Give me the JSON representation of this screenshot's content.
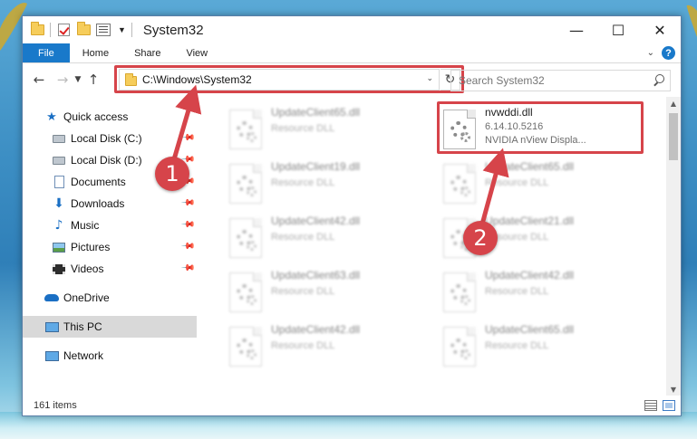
{
  "window": {
    "title": "System32",
    "controls": {
      "minimize": "—",
      "maximize": "☐",
      "close": "✕"
    }
  },
  "ribbon": {
    "tabs": [
      "File",
      "Home",
      "Share",
      "View"
    ],
    "help": "?"
  },
  "nav": {
    "address": "C:\\Windows\\System32",
    "search_placeholder": "Search System32"
  },
  "sidebar": {
    "items": [
      {
        "label": "Quick access",
        "icon": "star-icon",
        "pinned": false
      },
      {
        "label": "Local Disk (C:)",
        "icon": "drive-icon",
        "pinned": true
      },
      {
        "label": "Local Disk (D:)",
        "icon": "drive-icon",
        "pinned": true
      },
      {
        "label": "Documents",
        "icon": "documents-icon",
        "pinned": true
      },
      {
        "label": "Downloads",
        "icon": "download-icon",
        "pinned": true
      },
      {
        "label": "Music",
        "icon": "music-icon",
        "pinned": true
      },
      {
        "label": "Pictures",
        "icon": "pictures-icon",
        "pinned": true
      },
      {
        "label": "Videos",
        "icon": "videos-icon",
        "pinned": true
      },
      {
        "label": "OneDrive",
        "icon": "onedrive-icon",
        "pinned": false
      },
      {
        "label": "This PC",
        "icon": "this-pc-icon",
        "pinned": false,
        "selected": true
      },
      {
        "label": "Network",
        "icon": "network-icon",
        "pinned": false
      }
    ]
  },
  "files": {
    "featured": {
      "name": "nvwddi.dll",
      "version": "6.14.10.5216",
      "description": "NVIDIA nView Displa..."
    },
    "items": [
      {
        "name": "UpdateClient65.dll",
        "type": "Resource DLL"
      },
      {
        "name": "UpdateClient19.dll",
        "type": "Resource DLL"
      },
      {
        "name": "UpdateClient65.dll",
        "type": "Resource DLL"
      },
      {
        "name": "UpdateClient42.dll",
        "type": "Resource DLL"
      },
      {
        "name": "UpdateClient21.dll",
        "type": "Resource DLL"
      },
      {
        "name": "UpdateClient63.dll",
        "type": "Resource DLL"
      },
      {
        "name": "UpdateClient42.dll",
        "type": "Resource DLL"
      },
      {
        "name": "UpdateClient42.dll",
        "type": "Resource DLL"
      },
      {
        "name": "UpdateClient65.dll",
        "type": "Resource DLL"
      }
    ]
  },
  "status": {
    "item_count": "161 items"
  },
  "annotations": {
    "step1": "1",
    "step2": "2",
    "color": "#d6444a"
  }
}
